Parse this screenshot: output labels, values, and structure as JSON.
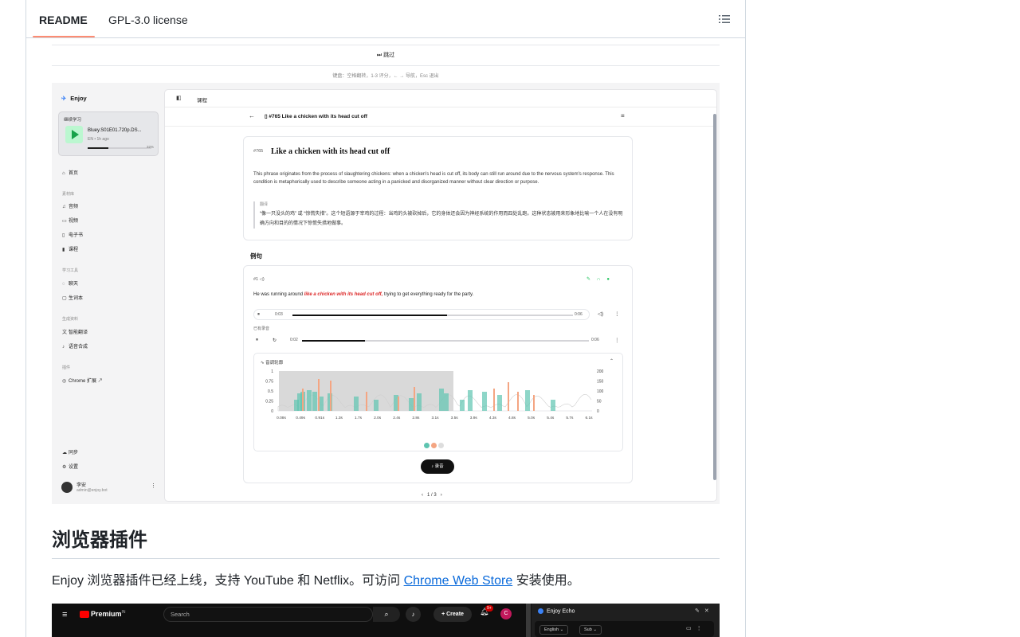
{
  "tabs": {
    "readme": "README",
    "license": "GPL-3.0 license"
  },
  "app": {
    "skip_label": "跳过",
    "keyboard_hint": "键盘：空格翻转，1-3 评分，← → 导航，Esc 退出",
    "logo": "Enjoy",
    "recent": {
      "label": "继续学习",
      "title": "Bluey.S01E01.720p.DS...",
      "meta": "EN • 1h ago",
      "percent": "32%",
      "progress": 0.32
    },
    "sidebar": {
      "home": "首页",
      "group_materials": "素材库",
      "audio": "音频",
      "video": "视频",
      "ebook": "电子书",
      "course": "课程",
      "group_tools": "学习工具",
      "chat": "聊天",
      "vocab": "生词本",
      "group_ai": "生成资料",
      "translate": "智能翻译",
      "tts": "语音合成",
      "group_plugins": "插件",
      "chrome_ext": "Chrome 扩展",
      "sync": "同步",
      "settings": "设置",
      "user_name": "李安",
      "user_email": "admin@enjoy.bot"
    },
    "main": {
      "crumb": "课程",
      "lesson_title": "#765 Like a chicken with its head cut off",
      "def_num": "#765",
      "def_title": "Like a chicken with its head cut off",
      "def_body": "This phrase originates from the process of slaughtering chickens: when a chicken's head is cut off, its body can still run around due to the nervous system's response. This condition is metaphorically used to describe someone acting in a panicked and disorganized manner without clear direction or purpose.",
      "trans_label": "翻译",
      "trans_text": "“像一只没头的鸡” 或 “惊慌失措”。这个短语源于宰鸡的过程：当鸡的头被砍掉后，它的身体还会因为神经系统的作用而四处乱跑。这种状态被用来形象地比喻一个人在没有明确方向和目的的情况下惊慌失措地做事。",
      "examples_heading": "例句",
      "ex_num": "#1",
      "ex_before": "He was running around ",
      "ex_highlight": "like a chicken with its head cut off,",
      "ex_after": " trying to get everything ready for the party.",
      "audio1": {
        "current": "0:03",
        "total": "0:06",
        "progress": 0.55
      },
      "recordings_label": "已有录音",
      "audio2": {
        "current": "0:02",
        "total": "0:06",
        "progress": 0.22
      },
      "pitch_label": "音调轮廓",
      "record_button": "录音",
      "pager": "1 / 3"
    }
  },
  "markdown": {
    "heading": "浏览器插件",
    "para_before": "Enjoy 浏览器插件已经上线，支持 YouTube 和 Netflix。可访问 ",
    "link_text": "Chrome Web Store",
    "para_after": " 安装使用。"
  },
  "youtube": {
    "logo": "Premium",
    "logo_sup": "IN",
    "search_placeholder": "Search",
    "create": "Create",
    "notif_count": "9+",
    "avatar": "C",
    "echo_title": "Enjoy Echo",
    "chip_lang": "English",
    "chip_sub": "Sub"
  },
  "chart_data": {
    "type": "area",
    "left_axis_ticks": [
      "1",
      "0.75",
      "0.5",
      "0.25",
      "0"
    ],
    "right_axis_ticks": [
      "200",
      "150",
      "100",
      "50",
      "0"
    ],
    "x_ticks": [
      "0.08s",
      "0.49s",
      "0.91s",
      "1.3s",
      "1.7s",
      "2.0s",
      "2.4s",
      "2.8s",
      "3.1s",
      "3.5s",
      "3.9s",
      "4.3s",
      "4.8s",
      "5.0s",
      "5.4s",
      "5.7s",
      "6.1s"
    ],
    "series": [
      {
        "color": "#5ec4b0"
      },
      {
        "color": "#f4a582"
      }
    ]
  },
  "colors": {
    "accent_tab": "#fd8c73",
    "link": "#0969da",
    "teal": "#5ec4b0",
    "orange": "#f4a582"
  }
}
